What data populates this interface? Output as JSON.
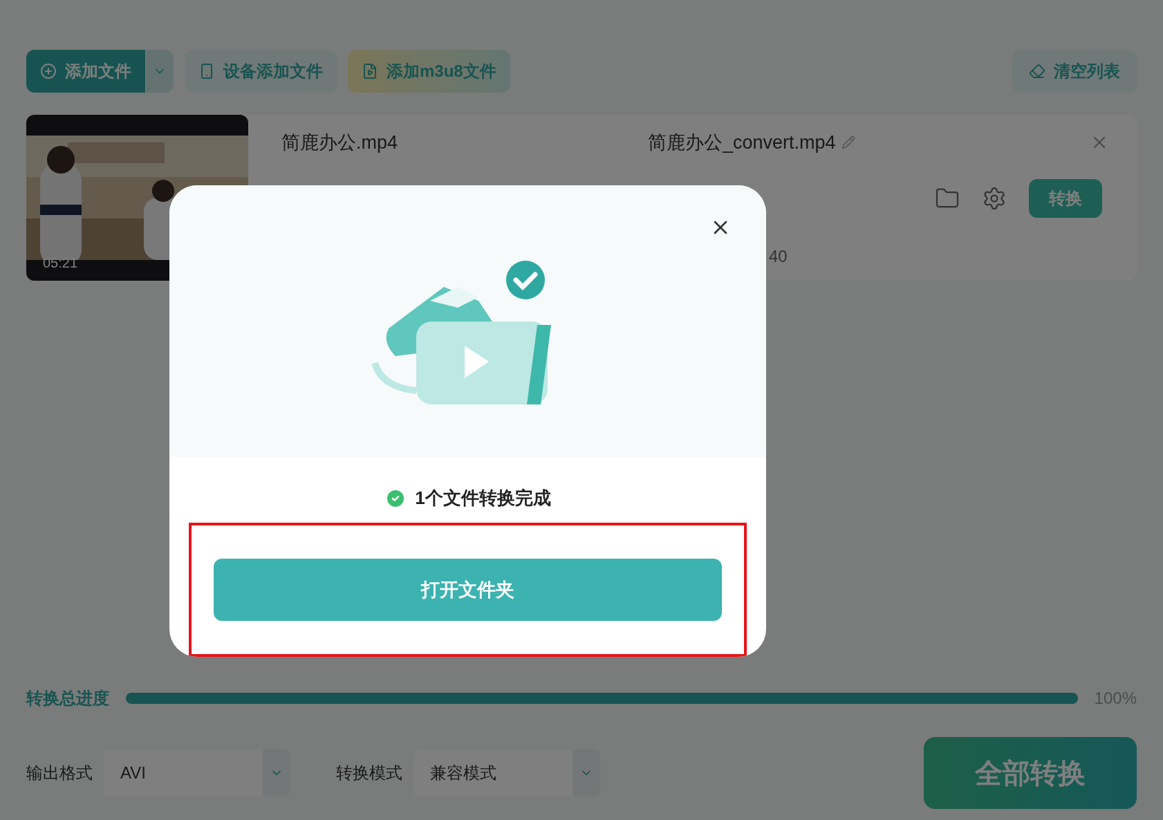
{
  "toolbar": {
    "buttons": [
      {
        "kind": "primary",
        "label": "添加文件"
      },
      {
        "kind": "device",
        "label": "设备添加文件"
      },
      {
        "kind": "m3u8",
        "label": "添加m3u8文件"
      }
    ],
    "clear_button": "清空列表"
  },
  "file": {
    "duration": "05:21",
    "source_name": "简鹿办公.mp4",
    "output_name": "简鹿办公_convert.mp4",
    "info_fragment": "40",
    "convert_button": "转换"
  },
  "progress": {
    "label": "转换总进度",
    "level": 1,
    "reading": "100%"
  },
  "settings": [
    {
      "label": "输出格式",
      "value": "AVI"
    },
    {
      "label": "转换模式",
      "value": "兼容模式"
    }
  ],
  "convert_all_button": "全部转换",
  "dialog": {
    "message": "1个文件转换完成",
    "button": "打开文件夹",
    "highlighted": true
  }
}
